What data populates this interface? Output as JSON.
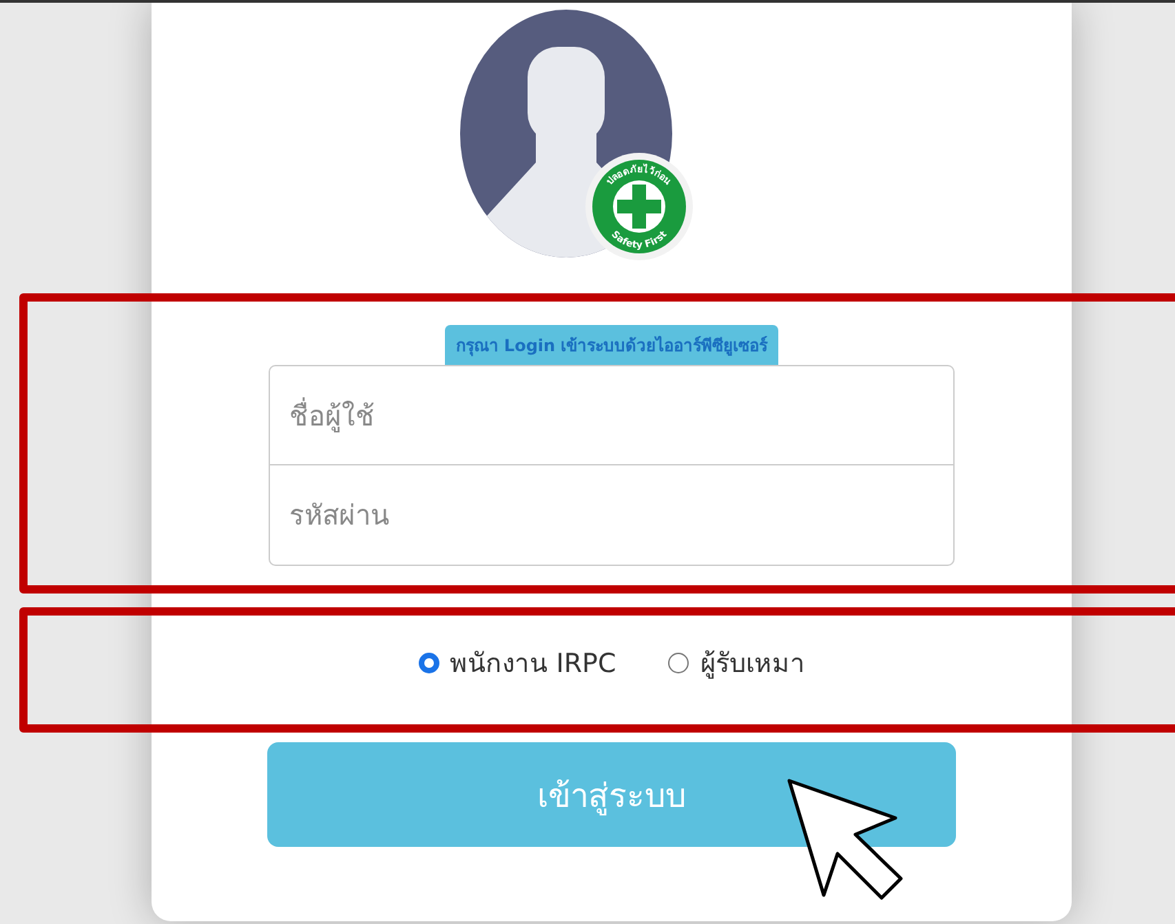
{
  "badge": {
    "top_text": "ปลอดภัยไว้ก่อน",
    "bottom_text": "Safety First"
  },
  "banner": "กรุณา Login เข้าระบบด้วยไออาร์พีซียูเซอร์",
  "fields": [
    {
      "placeholder": "ชื่อผู้ใช้"
    },
    {
      "placeholder": "รหัสผ่าน"
    }
  ],
  "user_types": [
    {
      "label": "พนักงาน IRPC",
      "selected": true
    },
    {
      "label": "ผู้รับเหมา",
      "selected": false
    }
  ],
  "login_button": "เข้าสู่ระบบ"
}
